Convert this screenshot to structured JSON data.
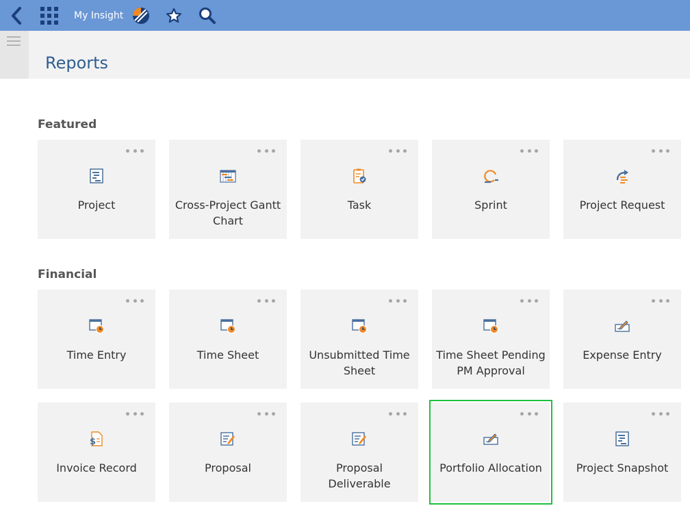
{
  "app": {
    "brand": "My Insight"
  },
  "page": {
    "title": "Reports"
  },
  "sections": [
    {
      "title": "Featured",
      "tiles": [
        {
          "label": "Project",
          "icon": "project-report-icon"
        },
        {
          "label": "Cross-Project Gantt Chart",
          "icon": "gantt-chart-icon"
        },
        {
          "label": "Task",
          "icon": "task-clipboard-icon"
        },
        {
          "label": "Sprint",
          "icon": "sprint-cycle-icon"
        },
        {
          "label": "Project Request",
          "icon": "project-request-icon"
        }
      ]
    },
    {
      "title": "Financial",
      "tiles": [
        {
          "label": "Time Entry",
          "icon": "calendar-clock-icon"
        },
        {
          "label": "Time Sheet",
          "icon": "calendar-clock-icon"
        },
        {
          "label": "Unsubmitted Time Sheet",
          "icon": "calendar-clock-icon"
        },
        {
          "label": "Time Sheet Pending PM Approval",
          "icon": "calendar-clock-icon"
        },
        {
          "label": "Expense Entry",
          "icon": "check-pen-icon"
        },
        {
          "label": "Invoice Record",
          "icon": "invoice-dollar-icon"
        },
        {
          "label": "Proposal",
          "icon": "proposal-edit-icon"
        },
        {
          "label": "Proposal Deliverable",
          "icon": "proposal-edit-icon"
        },
        {
          "label": "Portfolio Allocation",
          "icon": "check-pen-icon",
          "selected": true
        },
        {
          "label": "Project Snapshot",
          "icon": "project-report-icon"
        }
      ]
    }
  ],
  "colors": {
    "topbar": "#6a97d6",
    "accent": "#2f5e91",
    "selected_outline": "#1fbf3f",
    "tile_bg": "#f2f2f2"
  }
}
